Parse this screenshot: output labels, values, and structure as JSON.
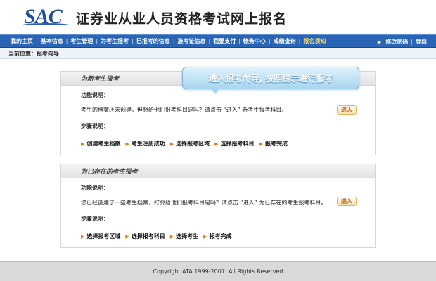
{
  "header": {
    "logo_text": "SAC",
    "site_title": "证券业从业人员资格考试网上报名"
  },
  "nav": {
    "items": [
      "我的主页",
      "基本信息",
      "考生管理",
      "为考生报考",
      "已报考的信息",
      "准考证信息",
      "我要支付",
      "帐务中心",
      "成绩查询"
    ],
    "active_item": "报名须知",
    "right_items": [
      "修改密码",
      "登出"
    ]
  },
  "breadcrumb": {
    "label": "当前位置：",
    "current": "报考向导"
  },
  "callout": {
    "text": "进入报考向导, 按照提示进行报考"
  },
  "panels": [
    {
      "title": "为新考生报考",
      "function_label": "功能说明：",
      "description": "考生的档案还未创建，但想给他们报考科目是吗？请点击 “进入” 新考生报考科目。",
      "steps_label": "步骤说明：",
      "steps": [
        "创建考生档案",
        "考生注册成功",
        "选择报考区域",
        "选择报考科目",
        "报考完成"
      ],
      "enter_label": "进入"
    },
    {
      "title": "为已存在的考生报考",
      "function_label": "功能说明：",
      "description": "您已经创建了一些考生档案，打算给他们报考科目是吗？请点击 “进入” 为已存在的考生报考科目。",
      "steps_label": "步骤说明：",
      "steps": [
        "选择报考区域",
        "选择报考科目",
        "选择考生",
        "报考完成"
      ],
      "enter_label": "进入"
    }
  ],
  "footer": {
    "copyright": "Copyright ATA 1999-2007. All Rights Reserved"
  },
  "colors": {
    "nav_bg": "#2a64b4",
    "accent_orange": "#e07a10",
    "callout_bg": "#a8d6f0"
  },
  "icons": {
    "step_marker": "right-triangle-icon",
    "nav_right_marker": "right-triangle-icon"
  }
}
